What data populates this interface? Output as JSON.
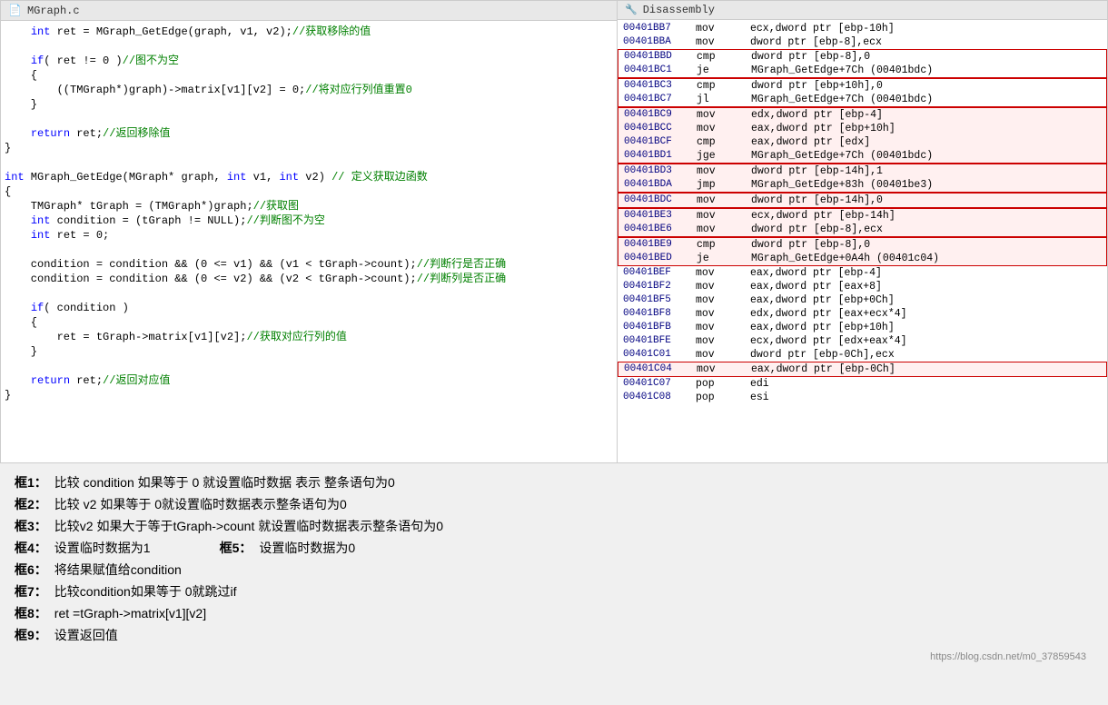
{
  "left_panel": {
    "title": "MGraph.c",
    "icon": "📄",
    "lines": [
      {
        "num": "",
        "text": "    int ret = MGraph_GetEdge(graph, v1, v2);//获取移除的值",
        "type": "code"
      },
      {
        "num": "",
        "text": "",
        "type": "blank"
      },
      {
        "num": "",
        "text": "    if( ret != 0 )//图不为空",
        "type": "code"
      },
      {
        "num": "",
        "text": "    {",
        "type": "code"
      },
      {
        "num": "",
        "text": "        ((TMGraph*)graph)->matrix[v1][v2] = 0;//将对应行列值重置0",
        "type": "code"
      },
      {
        "num": "",
        "text": "    }",
        "type": "code"
      },
      {
        "num": "",
        "text": "",
        "type": "blank"
      },
      {
        "num": "",
        "text": "    return ret;//返回移除值",
        "type": "code"
      },
      {
        "num": "",
        "text": "}",
        "type": "code"
      },
      {
        "num": "",
        "text": "",
        "type": "blank"
      },
      {
        "num": "",
        "text": "int MGraph_GetEdge(MGraph* graph, int v1, int v2) // 定义获取边函数",
        "type": "code"
      },
      {
        "num": "",
        "text": "{",
        "type": "code"
      },
      {
        "num": "",
        "text": "    TMGraph* tGraph = (TMGraph*)graph;//获取图",
        "type": "code"
      },
      {
        "num": "",
        "text": "    int condition = (tGraph != NULL);//判断图不为空",
        "type": "code"
      },
      {
        "num": "",
        "text": "    int ret = 0;",
        "type": "code"
      },
      {
        "num": "",
        "text": "",
        "type": "blank"
      },
      {
        "num": "",
        "text": "    condition = condition && (0 <= v1) && (v1 < tGraph->count);//判断行是否正确",
        "type": "code"
      },
      {
        "num": "",
        "text": "    condition = condition && (0 <= v2) && (v2 < tGraph->count);//判断列是否正确",
        "type": "code"
      },
      {
        "num": "",
        "text": "",
        "type": "blank"
      },
      {
        "num": "",
        "text": "    if( condition )",
        "type": "code"
      },
      {
        "num": "",
        "text": "    {",
        "type": "code"
      },
      {
        "num": "",
        "text": "        ret = tGraph->matrix[v1][v2];//获取对应行列的值",
        "type": "code"
      },
      {
        "num": "",
        "text": "    }",
        "type": "code"
      },
      {
        "num": "",
        "text": "",
        "type": "blank"
      },
      {
        "num": "",
        "text": "    return ret;//返回对应值",
        "type": "code"
      },
      {
        "num": "",
        "text": "}",
        "type": "code"
      }
    ]
  },
  "right_panel": {
    "title": "Disassembly",
    "rows": [
      {
        "addr": "00401BB7",
        "op": "mov",
        "args": "ecx,dword ptr [ebp-10h]",
        "box": "none"
      },
      {
        "addr": "00401BBA",
        "op": "mov",
        "args": "dword ptr [ebp-8],ecx",
        "box": "none"
      },
      {
        "addr": "00401BBD",
        "op": "cmp",
        "args": "dword ptr [ebp-8],0",
        "box": "box1-start"
      },
      {
        "addr": "00401BC1",
        "op": "je",
        "args": "MGraph_GetEdge+7Ch (00401bdc)",
        "box": "box1-end"
      },
      {
        "addr": "00401BC3",
        "op": "cmp",
        "args": "dword ptr [ebp+10h],0",
        "box": "box2-start"
      },
      {
        "addr": "00401BC7",
        "op": "jl",
        "args": "MGraph_GetEdge+7Ch (00401bdc)",
        "box": "box2-end"
      },
      {
        "addr": "00401BC9",
        "op": "mov",
        "args": "edx,dword ptr [ebp-4]",
        "box": "none"
      },
      {
        "addr": "00401BCC",
        "op": "mov",
        "args": "eax,dword ptr [ebp+10h]",
        "box": "none"
      },
      {
        "addr": "00401BCF",
        "op": "cmp",
        "args": "eax,dword ptr [edx]",
        "box": "none"
      },
      {
        "addr": "00401BD1",
        "op": "jge",
        "args": "MGraph_GetEdge+7Ch (00401bdc)",
        "box": "none"
      },
      {
        "addr": "00401BD3",
        "op": "mov",
        "args": "dword ptr [ebp-14h],1",
        "box": "box4-start"
      },
      {
        "addr": "00401BDA",
        "op": "jmp",
        "args": "MGraph_GetEdge+83h (00401be3)",
        "box": "box4-end"
      },
      {
        "addr": "00401BDC",
        "op": "mov",
        "args": "dword ptr [ebp-14h],0",
        "box": "box5"
      },
      {
        "addr": "00401BE3",
        "op": "mov",
        "args": "ecx,dword ptr [ebp-14h]",
        "box": "box6-start"
      },
      {
        "addr": "00401BE6",
        "op": "mov",
        "args": "dword ptr [ebp-8],ecx",
        "box": "box6-end"
      },
      {
        "addr": "00401BE9",
        "op": "cmp",
        "args": "dword ptr [ebp-8],0",
        "box": "box7-start"
      },
      {
        "addr": "00401BED",
        "op": "je",
        "args": "MGraph_GetEdge+0A4h (00401c04)",
        "box": "box7-end"
      },
      {
        "addr": "00401BEF",
        "op": "mov",
        "args": "eax,dword ptr [ebp-4]",
        "box": "none"
      },
      {
        "addr": "00401BF2",
        "op": "mov",
        "args": "eax,dword ptr [eax+8]",
        "box": "none"
      },
      {
        "addr": "00401BF5",
        "op": "mov",
        "args": "eax,dword ptr [ebp+0Ch]",
        "box": "none"
      },
      {
        "addr": "00401BF8",
        "op": "mov",
        "args": "edx,dword ptr [eax+ecx*4]",
        "box": "none"
      },
      {
        "addr": "00401BFB",
        "op": "mov",
        "args": "eax,dword ptr [ebp+10h]",
        "box": "none"
      },
      {
        "addr": "00401BFE",
        "op": "mov",
        "args": "ecx,dword ptr [edx+eax*4]",
        "box": "none"
      },
      {
        "addr": "00401C01",
        "op": "mov",
        "args": "dword ptr [ebp-0Ch],ecx",
        "box": "none"
      },
      {
        "addr": "00401C04",
        "op": "mov",
        "args": "eax,dword ptr [ebp-0Ch]",
        "box": "box9"
      },
      {
        "addr": "00401C07",
        "op": "pop",
        "args": "edi",
        "box": "none"
      },
      {
        "addr": "00401C08",
        "op": "pop",
        "args": "esi",
        "box": "none"
      }
    ]
  },
  "annotations": [
    {
      "label": "框1：",
      "text": "比较 condition 如果等于 0 就设置临时数据 表示 整条语句为0"
    },
    {
      "label": "框2：",
      "text": "比较 v2 如果等于 0就设置临时数据表示整条语句为0"
    },
    {
      "label": "框3：",
      "text": "比较v2 如果大于等于tGraph->count  就设置临时数据表示整条语句为0"
    },
    {
      "label": "框4：",
      "text": "设置临时数据为1",
      "extra_label": "框5：",
      "extra_text": "设置临时数据为0"
    },
    {
      "label": "框6：",
      "text": "将结果赋值给condition"
    },
    {
      "label": "框7：",
      "text": "比较condition如果等于 0就跳过if"
    },
    {
      "label": "框8：",
      "text": "ret =tGraph->matrix[v1][v2]"
    },
    {
      "label": "框9：",
      "text": "设置返回值"
    }
  ],
  "watermark": "https://blog.csdn.net/m0_37859543"
}
